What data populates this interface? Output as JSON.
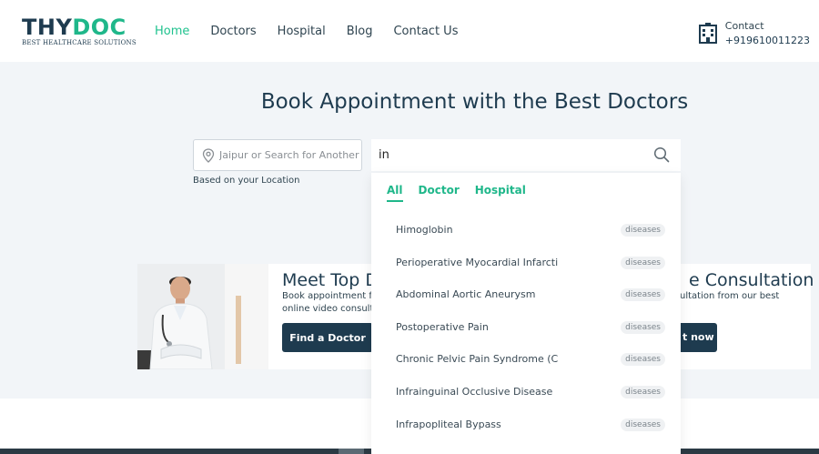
{
  "header": {
    "logo_part1": "THY",
    "logo_part2": "DOC",
    "tagline": "BEST HEALTHCARE SOLUTIONS",
    "nav": [
      {
        "label": "Home",
        "active": true
      },
      {
        "label": "Doctors",
        "active": false
      },
      {
        "label": "Hospital",
        "active": false
      },
      {
        "label": "Blog",
        "active": false
      },
      {
        "label": "Contact Us",
        "active": false
      }
    ],
    "contact_label": "Contact",
    "contact_phone": "+919610011223",
    "contact_icon": "hospital-building-icon"
  },
  "hero": {
    "title": "Book Appointment with the Best Doctors",
    "location_placeholder": "Jaipur or Search for Another",
    "location_caption": "Based on your Location",
    "search_value": "in",
    "search_icon": "search-icon"
  },
  "banner": {
    "heading_left": "Meet Top D",
    "heading_right": "e Consultation",
    "desc_line1": "Book appointment f",
    "desc_line2": "online video consult",
    "desc_right": "ultation from our best",
    "find_button": "Find a Doctor",
    "right_button": "t now"
  },
  "dropdown": {
    "tabs": [
      {
        "label": "All",
        "active": true
      },
      {
        "label": "Doctor",
        "active": false
      },
      {
        "label": "Hospital",
        "active": false
      }
    ],
    "results": [
      {
        "label": "Himoglobin",
        "badge": "diseases"
      },
      {
        "label": "Perioperative Myocardial Infarcti",
        "badge": "diseases"
      },
      {
        "label": "Abdominal Aortic Aneurysm",
        "badge": "diseases"
      },
      {
        "label": "Postoperative Pain",
        "badge": "diseases"
      },
      {
        "label": "Chronic Pelvic Pain Syndrome (C",
        "badge": "diseases"
      },
      {
        "label": "Infrainguinal Occlusive Disease",
        "badge": "diseases"
      },
      {
        "label": "Infrapopliteal Bypass",
        "badge": "diseases"
      }
    ]
  },
  "colors": {
    "brand_dark": "#1e3b4f",
    "brand_green": "#1fb78a",
    "hero_bg": "#f2f5f8"
  }
}
